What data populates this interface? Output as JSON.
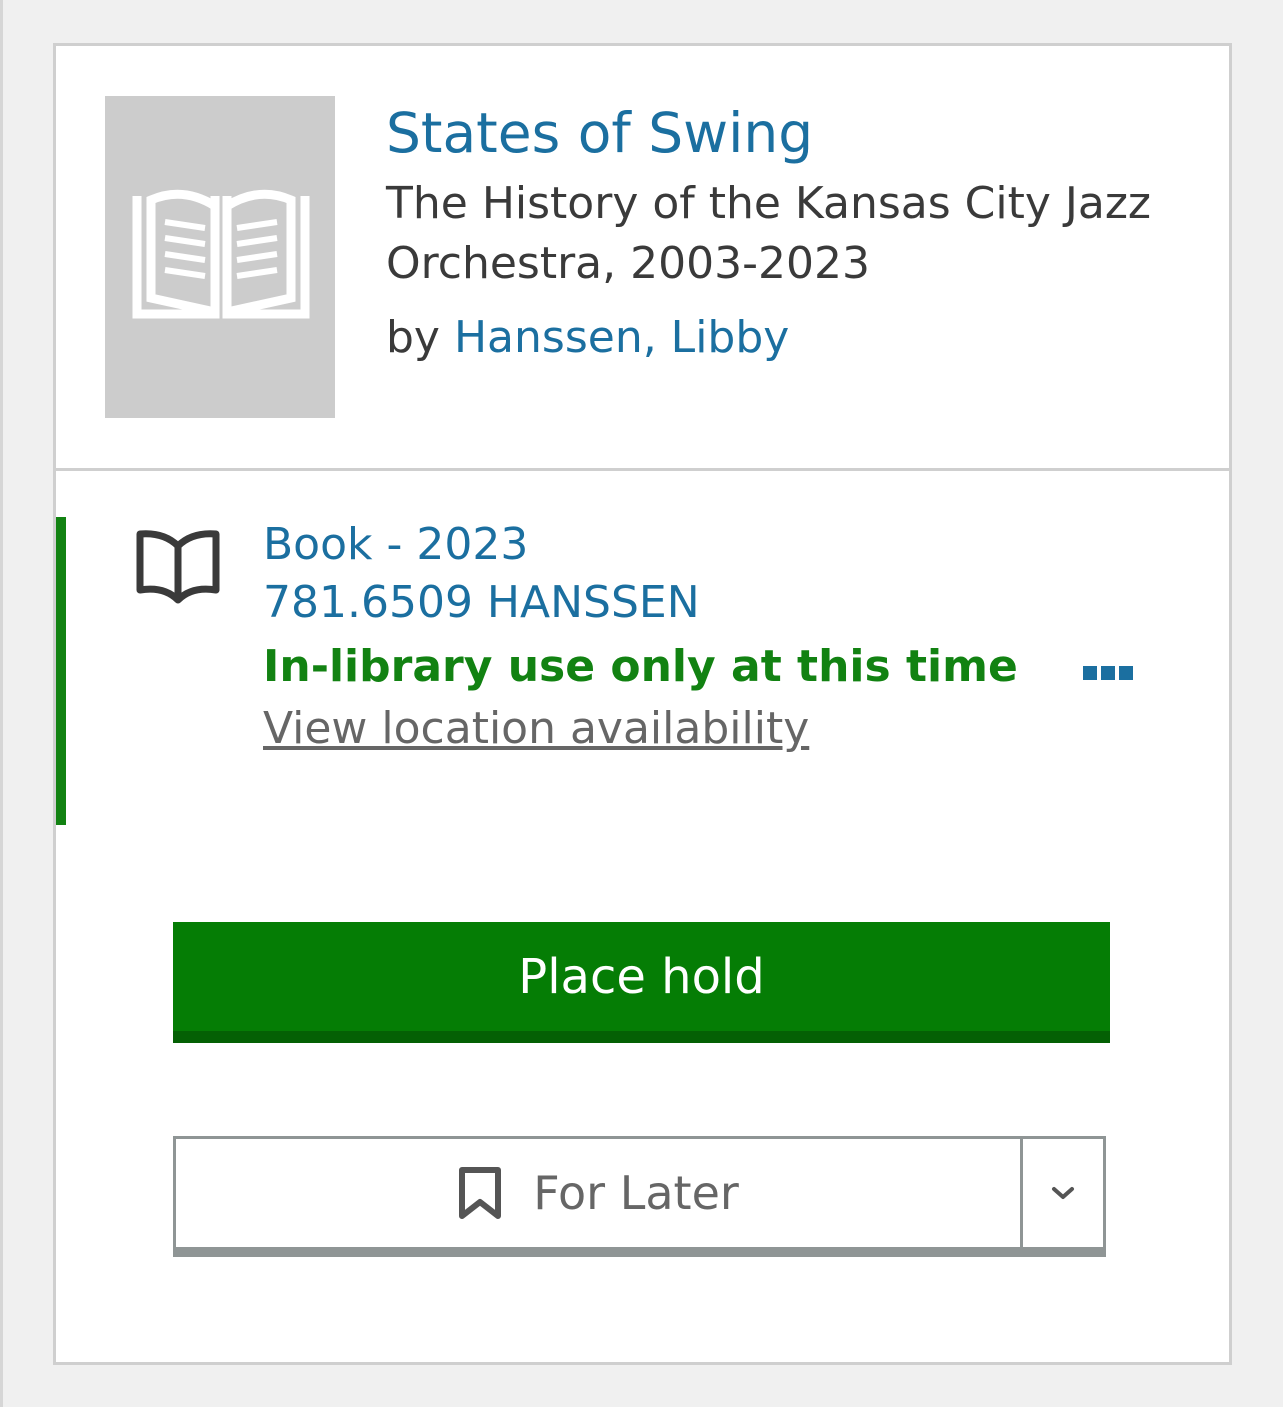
{
  "item": {
    "title": "States of Swing",
    "subtitle": "The History of the Kansas City Jazz Orchestra, 2003-2023",
    "by_prefix": "by",
    "author": "Hanssen, Libby",
    "cover_icon": "open-book-placeholder-icon"
  },
  "availability": {
    "format": "Book - 2023",
    "call_number": "781.6509 HANSSEN",
    "status": "In-library use only at this time",
    "location_link": "View location availability",
    "format_icon": "book-icon",
    "more_icon": "more-options-icon"
  },
  "actions": {
    "place_hold": "Place hold",
    "for_later": "For Later",
    "for_later_icon": "bookmark-icon",
    "dropdown_icon": "chevron-down-icon"
  },
  "colors": {
    "link_blue": "#1b6fa0",
    "available_green": "#128212",
    "button_green": "#057d05",
    "text_dark": "#3a3a3a",
    "border_gray": "#cfcfcf"
  }
}
